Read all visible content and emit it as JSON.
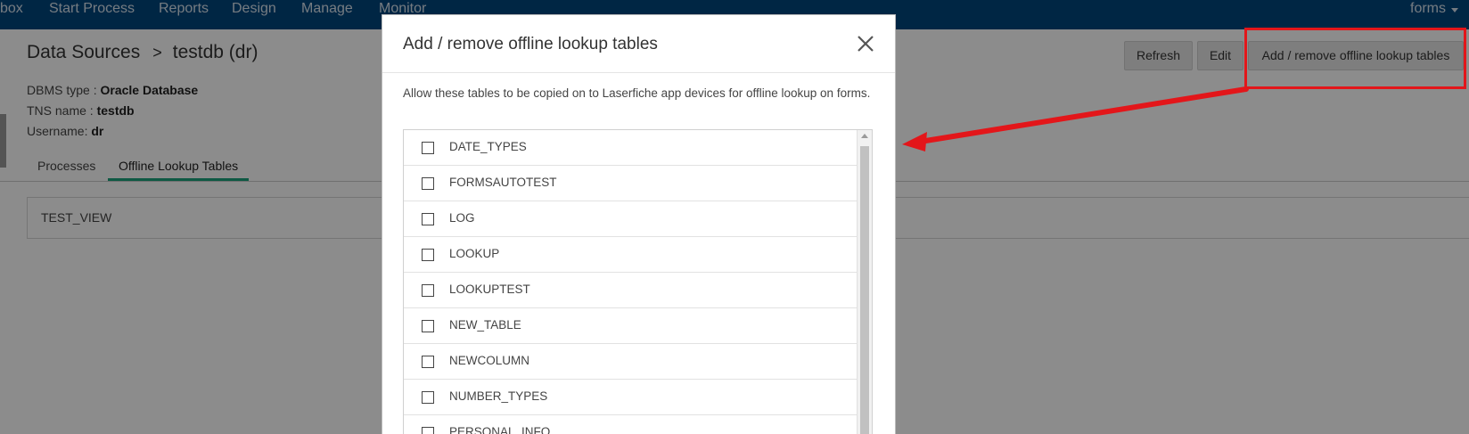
{
  "nav": {
    "items": [
      "box",
      "Start Process",
      "Reports",
      "Design",
      "Manage",
      "Monitor"
    ],
    "user": "forms"
  },
  "page": {
    "breadcrumb_root": "Data Sources",
    "breadcrumb_sep": ">",
    "breadcrumb_current": "testdb (dr)",
    "meta": [
      {
        "label": "DBMS type",
        "value": "Oracle Database"
      },
      {
        "label": "TNS name",
        "value": "testdb"
      },
      {
        "label": "Username:",
        "value": "dr"
      }
    ],
    "tabs": [
      "Processes",
      "Offline Lookup Tables"
    ],
    "active_tab": "Offline Lookup Tables",
    "tables": [
      "TEST_VIEW"
    ]
  },
  "toolbar": {
    "refresh_label": "Refresh",
    "edit_label": "Edit",
    "add_remove_label": "Add / remove offline lookup tables"
  },
  "modal": {
    "title": "Add / remove offline lookup tables",
    "description": "Allow these tables to be copied on to Laserfiche app devices for offline lookup on forms.",
    "tables": [
      {
        "name": "DATE_TYPES",
        "checked": false
      },
      {
        "name": "FORMSAUTOTEST",
        "checked": false
      },
      {
        "name": "LOG",
        "checked": false
      },
      {
        "name": "LOOKUP",
        "checked": false
      },
      {
        "name": "LOOKUPTEST",
        "checked": false
      },
      {
        "name": "NEW_TABLE",
        "checked": false
      },
      {
        "name": "NEWCOLUMN",
        "checked": false
      },
      {
        "name": "NUMBER_TYPES",
        "checked": false
      },
      {
        "name": "PERSONAL_INFO",
        "checked": false
      }
    ]
  },
  "colors": {
    "nav_bg": "#00457c",
    "tab_active": "#1aa37a",
    "annotation": "#e3161a"
  }
}
